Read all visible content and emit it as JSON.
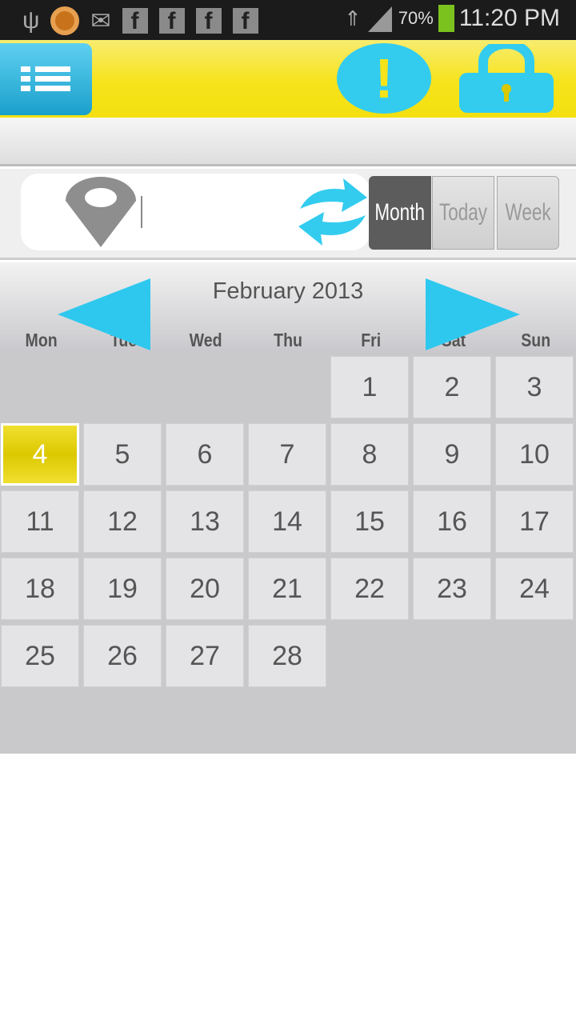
{
  "status_bar": {
    "battery": "70%",
    "time": "11:20 PM",
    "icons": [
      "usb-icon",
      "app-icon",
      "email-icon",
      "facebook-icon",
      "facebook-icon",
      "facebook-icon",
      "facebook-icon",
      "wifi-icon",
      "signal-icon",
      "battery-charging-icon"
    ]
  },
  "header": {
    "icons": [
      "menu-icon",
      "alert-icon",
      "lock-icon"
    ]
  },
  "search": {
    "value": "",
    "placeholder": ""
  },
  "view_modes": {
    "month": "Month",
    "today": "Today",
    "week": "Week",
    "selected": "Month"
  },
  "calendar": {
    "title": "February 2013",
    "weekdays": [
      "Mon",
      "Tue",
      "Wed",
      "Thu",
      "Fri",
      "Sat",
      "Sun"
    ],
    "days": [
      "1",
      "2",
      "3",
      "4",
      "5",
      "6",
      "7",
      "8",
      "9",
      "10",
      "11",
      "12",
      "13",
      "14",
      "15",
      "16",
      "17",
      "18",
      "19",
      "20",
      "21",
      "22",
      "23",
      "24",
      "25",
      "26",
      "27",
      "28"
    ],
    "first_weekday_index": 4,
    "selected_day": "4"
  },
  "colors": {
    "accent_blue": "#33ccef",
    "header_yellow": "#f6e31a",
    "selected": "#dcc800"
  }
}
